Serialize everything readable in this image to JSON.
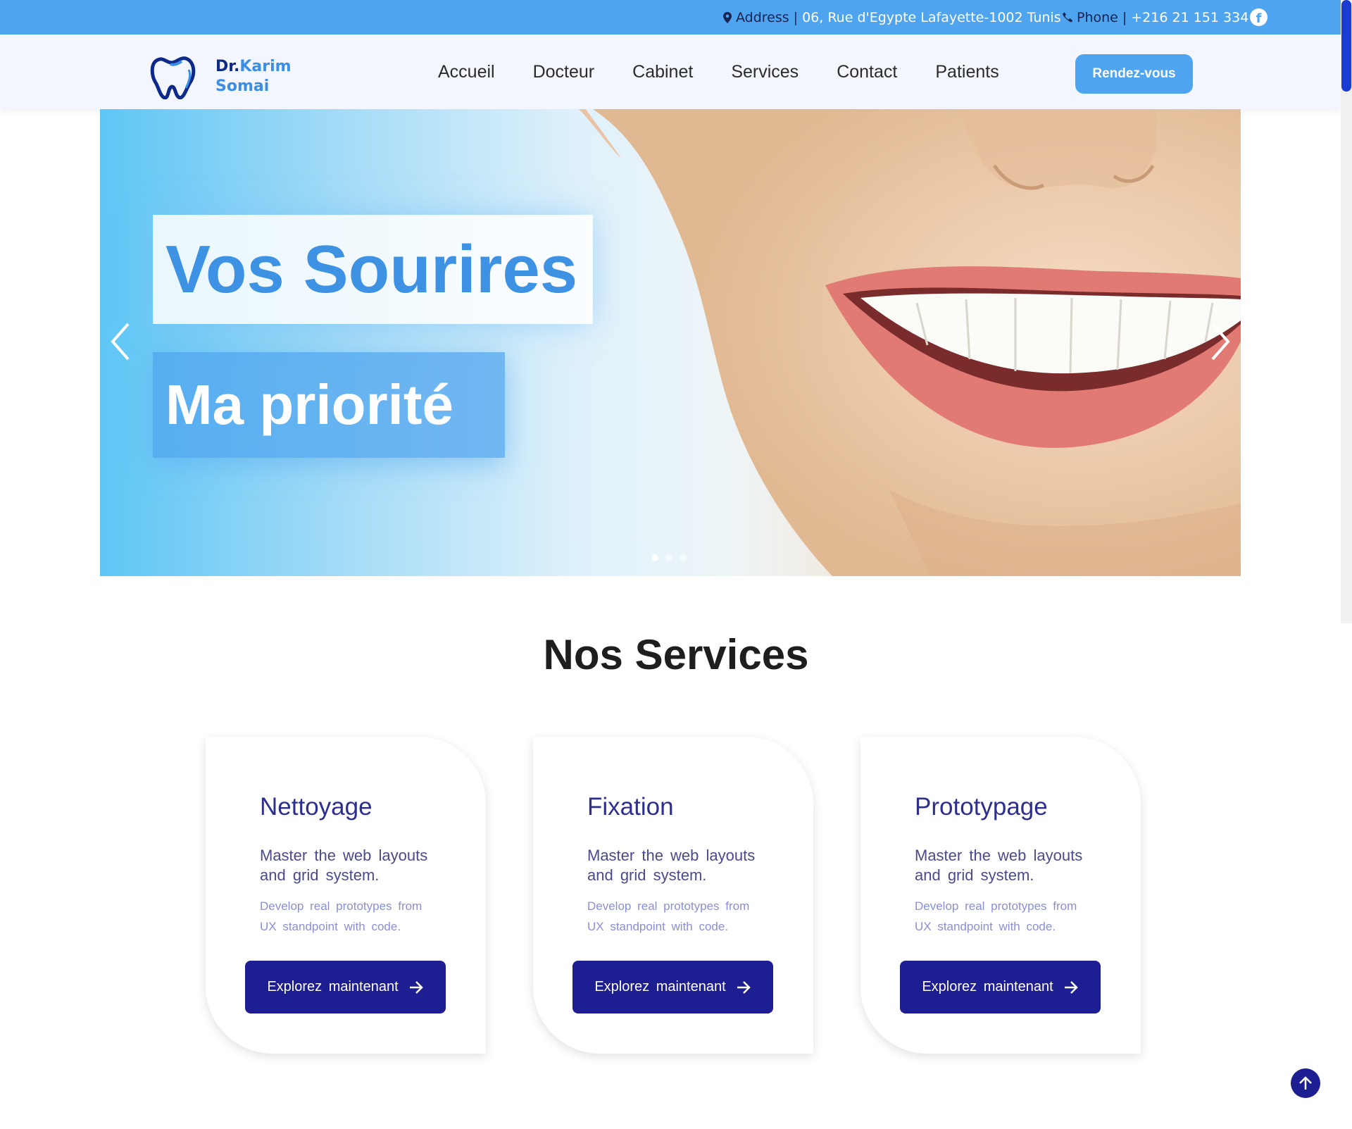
{
  "topbar": {
    "address_label": "Address",
    "address_value": "06, Rue d'Egypte Lafayette-1002 Tunis",
    "phone_label": "Phone",
    "phone_value": "+216 21 151 334",
    "separator": "|"
  },
  "logo": {
    "dr": "Dr.",
    "first_name": "Karim",
    "last_name": "Somai"
  },
  "nav": {
    "items": [
      "Accueil",
      "Docteur",
      "Cabinet",
      "Services",
      "Contact",
      "Patients"
    ]
  },
  "cta": {
    "label": "Rendez-vous"
  },
  "hero": {
    "headline_1": "Vos Sourires",
    "headline_2": "Ma priorité",
    "slide_count": 3,
    "active_slide": 1
  },
  "services": {
    "title": "Nos Services",
    "cards": [
      {
        "title": "Nettoyage",
        "desc": "Master the web layouts and grid system.",
        "sub": "Develop real prototypes from UX standpoint with code.",
        "button": "Explorez maintenant"
      },
      {
        "title": "Fixation",
        "desc": "Master the web layouts and grid system.",
        "sub": "Develop real prototypes from UX standpoint with code.",
        "button": "Explorez maintenant"
      },
      {
        "title": "Prototypage",
        "desc": "Master the web layouts and grid system.",
        "sub": "Develop real prototypes from UX standpoint with code.",
        "button": "Explorez maintenant"
      }
    ]
  },
  "colors": {
    "accent": "#4ea4ee",
    "primary_dark": "#1c1e92",
    "title_blue": "#2d2f8f"
  },
  "icons": [
    "map-marker-icon",
    "phone-icon",
    "facebook-icon",
    "tooth-logo-icon",
    "chevron-left-icon",
    "chevron-right-icon",
    "arrow-right-icon",
    "arrow-up-icon"
  ]
}
